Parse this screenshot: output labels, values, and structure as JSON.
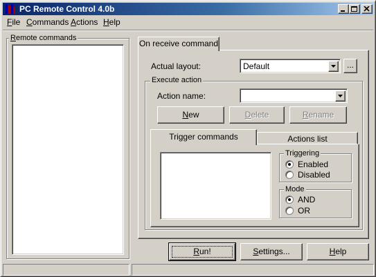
{
  "window": {
    "title": "PC Remote Control 4.0b",
    "controls": [
      "minimize-icon",
      "maximize-icon",
      "close-icon"
    ]
  },
  "menu": {
    "file": {
      "key": "F",
      "rest": "ile"
    },
    "commands": {
      "key": "C",
      "rest": "ommands"
    },
    "actions": {
      "key": "A",
      "rest": "ctions"
    },
    "help": {
      "key": "H",
      "rest": "elp"
    }
  },
  "remote_commands": {
    "label_key": "R",
    "label_rest": "emote commands",
    "items": []
  },
  "tabs": {
    "on_receive": "On receive command"
  },
  "layout": {
    "label": "Actual layout:",
    "value": "Default",
    "browse_label": "..."
  },
  "execute_action": {
    "group_label": "Execute action",
    "action_name_label": "Action name:",
    "action_name_value": "",
    "new_key": "N",
    "new_rest": "ew",
    "delete_key": "D",
    "delete_rest": "elete",
    "rename_key": "R",
    "rename_rest": "ename"
  },
  "subtabs": {
    "trigger": "Trigger commands",
    "actions": "Actions list"
  },
  "triggering": {
    "group_label": "Triggering",
    "options": [
      "Enabled",
      "Disabled"
    ],
    "selected": "Enabled"
  },
  "mode": {
    "group_label": "Mode",
    "options": [
      "AND",
      "OR"
    ],
    "selected": "AND"
  },
  "buttons": {
    "run_key": "R",
    "run_rest": "un!",
    "settings_key": "S",
    "settings_rest": "ettings...",
    "help_key": "H",
    "help_rest": "elp"
  },
  "colors": {
    "face": "#d4d0c8",
    "title_start": "#0a246a",
    "title_end": "#a6caf0",
    "disabled_text": "#808080"
  }
}
